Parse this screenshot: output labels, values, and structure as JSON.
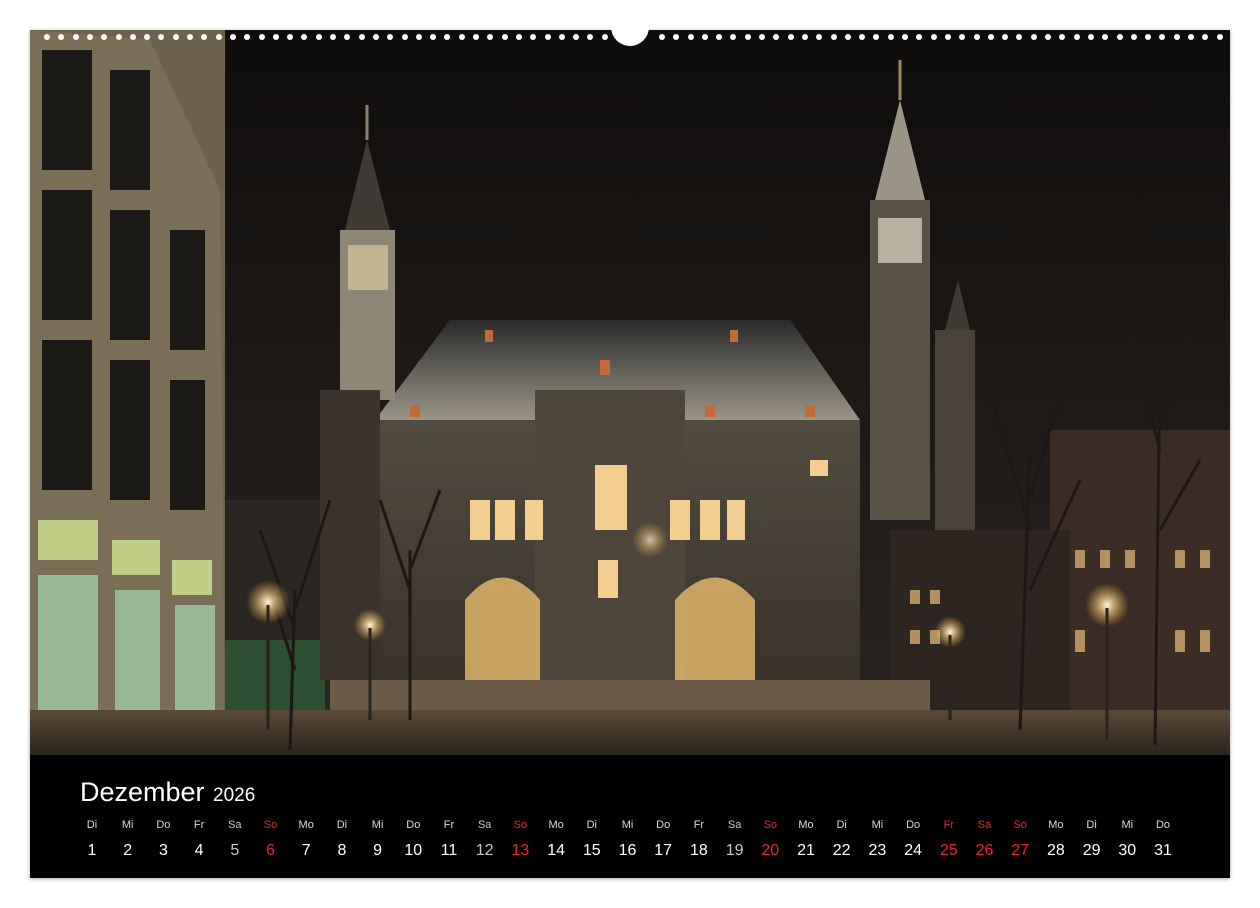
{
  "calendar": {
    "month": "Dezember",
    "year": "2026",
    "days": [
      {
        "dow": "Di",
        "num": "1"
      },
      {
        "dow": "Mi",
        "num": "2"
      },
      {
        "dow": "Do",
        "num": "3"
      },
      {
        "dow": "Fr",
        "num": "4"
      },
      {
        "dow": "Sa",
        "num": "5"
      },
      {
        "dow": "So",
        "num": "6"
      },
      {
        "dow": "Mo",
        "num": "7"
      },
      {
        "dow": "Di",
        "num": "8"
      },
      {
        "dow": "Mi",
        "num": "9"
      },
      {
        "dow": "Do",
        "num": "10"
      },
      {
        "dow": "Fr",
        "num": "11"
      },
      {
        "dow": "Sa",
        "num": "12"
      },
      {
        "dow": "So",
        "num": "13"
      },
      {
        "dow": "Mo",
        "num": "14"
      },
      {
        "dow": "Di",
        "num": "15"
      },
      {
        "dow": "Mi",
        "num": "16"
      },
      {
        "dow": "Do",
        "num": "17"
      },
      {
        "dow": "Fr",
        "num": "18"
      },
      {
        "dow": "Sa",
        "num": "19"
      },
      {
        "dow": "So",
        "num": "20"
      },
      {
        "dow": "Mo",
        "num": "21"
      },
      {
        "dow": "Di",
        "num": "22"
      },
      {
        "dow": "Mi",
        "num": "23"
      },
      {
        "dow": "Do",
        "num": "24"
      },
      {
        "dow": "Fr",
        "num": "25"
      },
      {
        "dow": "Sa",
        "num": "26"
      },
      {
        "dow": "So",
        "num": "27"
      },
      {
        "dow": "Mo",
        "num": "28"
      },
      {
        "dow": "Di",
        "num": "29"
      },
      {
        "dow": "Mi",
        "num": "30"
      },
      {
        "dow": "Do",
        "num": "31"
      }
    ],
    "holiday_days": [
      "6",
      "13",
      "20",
      "25",
      "26",
      "27"
    ],
    "weekend_days": [
      "5",
      "12",
      "19"
    ],
    "colors": {
      "holiday": "#e8242c",
      "text": "#ffffff",
      "background": "#000000"
    }
  },
  "photo": {
    "subject": "illuminated-town-hall-at-night"
  }
}
